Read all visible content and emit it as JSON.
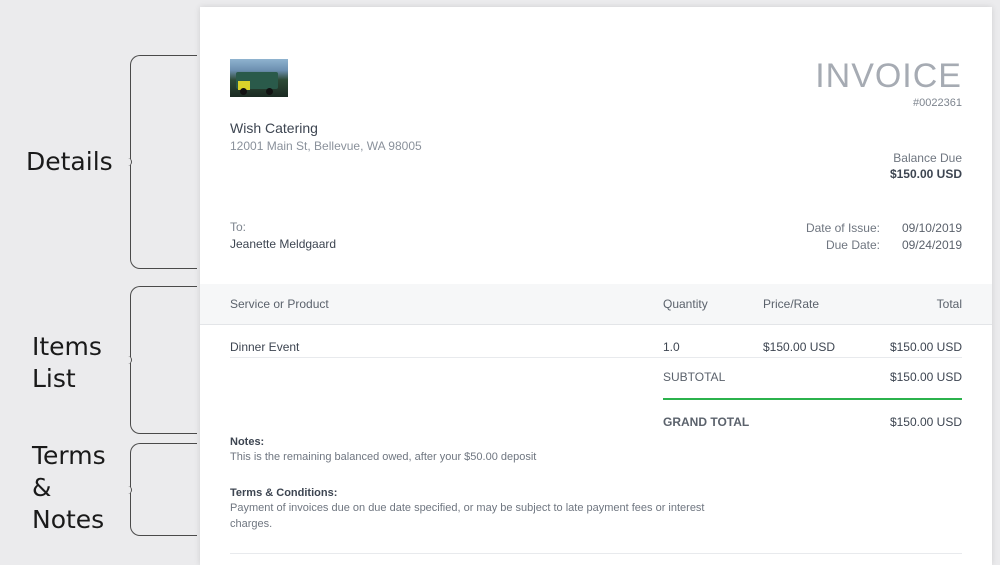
{
  "annotations": {
    "details": "Details",
    "items_list": "Items\nList",
    "terms_notes": "Terms\n&\nNotes"
  },
  "invoice": {
    "title": "INVOICE",
    "number": "#0022361",
    "company": {
      "name": "Wish Catering",
      "address": "12001 Main St, Bellevue, WA 98005",
      "logo_icon": "food-truck-logo"
    },
    "balance_due": {
      "label": "Balance Due",
      "amount": "$150.00 USD"
    },
    "recipient": {
      "label": "To:",
      "name": "Jeanette Meldgaard"
    },
    "dates": {
      "issue_label": "Date of Issue:",
      "issue_value": "09/10/2019",
      "due_label": "Due Date:",
      "due_value": "09/24/2019"
    },
    "table": {
      "headers": [
        "Service or Product",
        "Quantity",
        "Price/Rate",
        "Total"
      ],
      "rows": [
        {
          "service": "Dinner Event",
          "quantity": "1.0",
          "rate": "$150.00 USD",
          "total": "$150.00 USD"
        }
      ]
    },
    "subtotal": {
      "label": "SUBTOTAL",
      "value": "$150.00 USD"
    },
    "grand_total": {
      "label": "GRAND TOTAL",
      "value": "$150.00 USD"
    },
    "notes": {
      "heading": "Notes:",
      "text": "This is the remaining balanced owed, after your $50.00 deposit"
    },
    "terms": {
      "heading": "Terms & Conditions:",
      "text": "Payment of invoices due on due date specified, or may be subject to late payment fees or interest charges."
    }
  },
  "colors": {
    "accent_green": "#2bb24c",
    "background": "#ebebed",
    "paper": "#ffffff"
  }
}
